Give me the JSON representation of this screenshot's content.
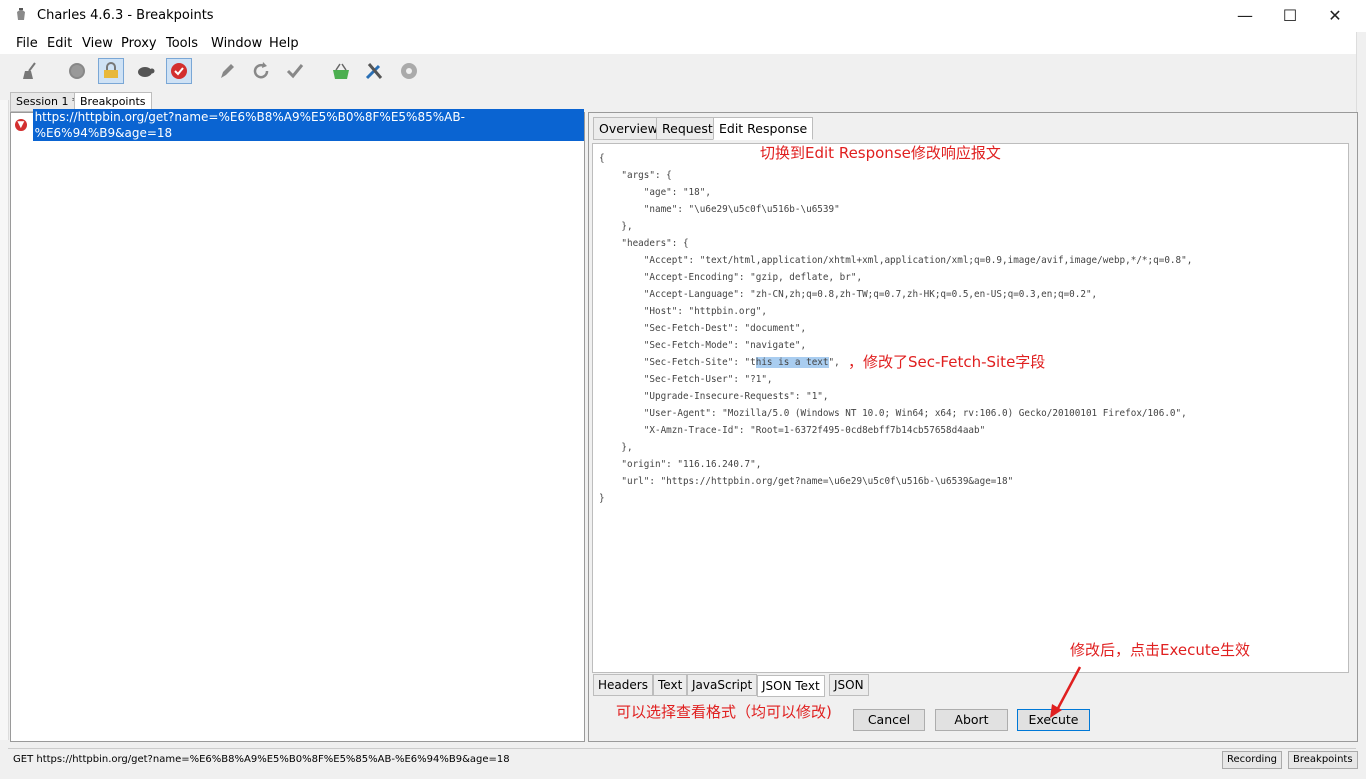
{
  "window": {
    "title": "Charles 4.6.3 - Breakpoints",
    "controls": {
      "minimize": "—",
      "maximize": "☐",
      "close": "✕"
    }
  },
  "menu": [
    "File",
    "Edit",
    "View",
    "Proxy",
    "Tools",
    "Window",
    "Help"
  ],
  "toolbar": [
    "broom-icon",
    "record-icon",
    "throttle-lock-icon",
    "turtle-icon",
    "breakpoint-icon",
    "pen-icon",
    "refresh-icon",
    "check-icon",
    "basket-icon",
    "tools-icon",
    "gear-icon"
  ],
  "session_tabs": [
    "Session 1 *",
    "Breakpoints"
  ],
  "request_list": {
    "url": "https://httpbin.org/get?name=%E6%B8%A9%E5%B0%8F%E5%85%AB-%E6%94%B9&age=18"
  },
  "top_tabs": [
    "Overview",
    "Request",
    "Edit Response"
  ],
  "editor": {
    "before_highlight": "{\n    \"args\": {\n        \"age\": \"18\",\n        \"name\": \"\\u6e29\\u5c0f\\u516b-\\u6539\"\n    },\n    \"headers\": {\n        \"Accept\": \"text/html,application/xhtml+xml,application/xml;q=0.9,image/avif,image/webp,*/*;q=0.8\",\n        \"Accept-Encoding\": \"gzip, deflate, br\",\n        \"Accept-Language\": \"zh-CN,zh;q=0.8,zh-TW;q=0.7,zh-HK;q=0.5,en-US;q=0.3,en;q=0.2\",\n        \"Host\": \"httpbin.org\",\n        \"Sec-Fetch-Dest\": \"document\",\n        \"Sec-Fetch-Mode\": \"navigate\",\n        \"Sec-Fetch-Site\": \"t",
    "highlight": "his is a text",
    "after_highlight": "\",\n        \"Sec-Fetch-User\": \"?1\",\n        \"Upgrade-Insecure-Requests\": \"1\",\n        \"User-Agent\": \"Mozilla/5.0 (Windows NT 10.0; Win64; x64; rv:106.0) Gecko/20100101 Firefox/106.0\",\n        \"X-Amzn-Trace-Id\": \"Root=1-6372f495-0cd8ebff7b14cb57658d4aab\"\n    },\n    \"origin\": \"116.16.240.7\",\n    \"url\": \"https://httpbin.org/get?name=\\u6e29\\u5c0f\\u516b-\\u6539&age=18\"\n}"
  },
  "bottom_tabs": [
    "Headers",
    "Text",
    "JavaScript",
    "JSON Text",
    "JSON"
  ],
  "buttons": {
    "cancel": "Cancel",
    "abort": "Abort",
    "execute": "Execute"
  },
  "annotations": {
    "switch_tab": "切换到Edit Response修改响应报文",
    "modified_field": "，修改了Sec-Fetch-Site字段",
    "execute_hint": "修改后，点击Execute生效",
    "format_hint": "可以选择查看格式（均可以修改)"
  },
  "status": {
    "text": "GET https://httpbin.org/get?name=%E6%B8%A9%E5%B0%8F%E5%85%AB-%E6%94%B9&age=18",
    "recording": "Recording",
    "breakpoints": "Breakpoints"
  },
  "colors": {
    "annotation": "#e02020",
    "selection": "#0a64d2",
    "highlight": "#a9cdf0"
  }
}
